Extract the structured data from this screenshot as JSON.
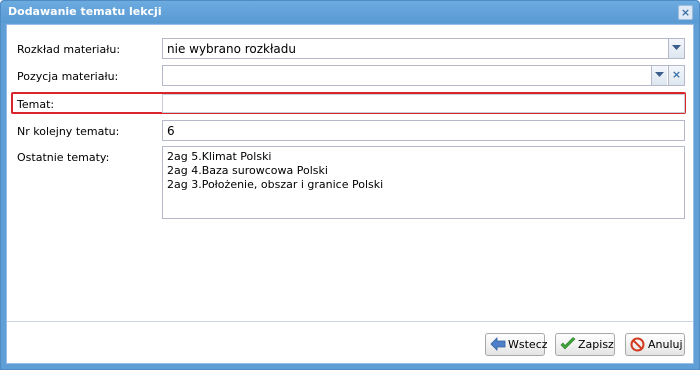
{
  "window": {
    "title": "Dodawanie tematu lekcji",
    "close_label": "×"
  },
  "form": {
    "rozklad": {
      "label": "Rozkład materiału:",
      "value": "nie wybrano rozkładu"
    },
    "pozycja": {
      "label": "Pozycja materiału:",
      "value": ""
    },
    "temat": {
      "label": "Temat:",
      "value": ""
    },
    "nr": {
      "label": "Nr kolejny tematu:",
      "value": "6"
    },
    "ostatnie": {
      "label": "Ostatnie tematy:",
      "items": [
        "2ag 5.Klimat Polski",
        "2ag 4.Baza surowcowa Polski",
        "2ag 3.Położenie, obszar i granice Polski"
      ]
    }
  },
  "buttons": {
    "back": "Wstecz",
    "save": "Zapisz",
    "cancel": "Anuluj"
  },
  "colors": {
    "titlebar": "#5a9ad3",
    "highlight": "#d9262b"
  }
}
